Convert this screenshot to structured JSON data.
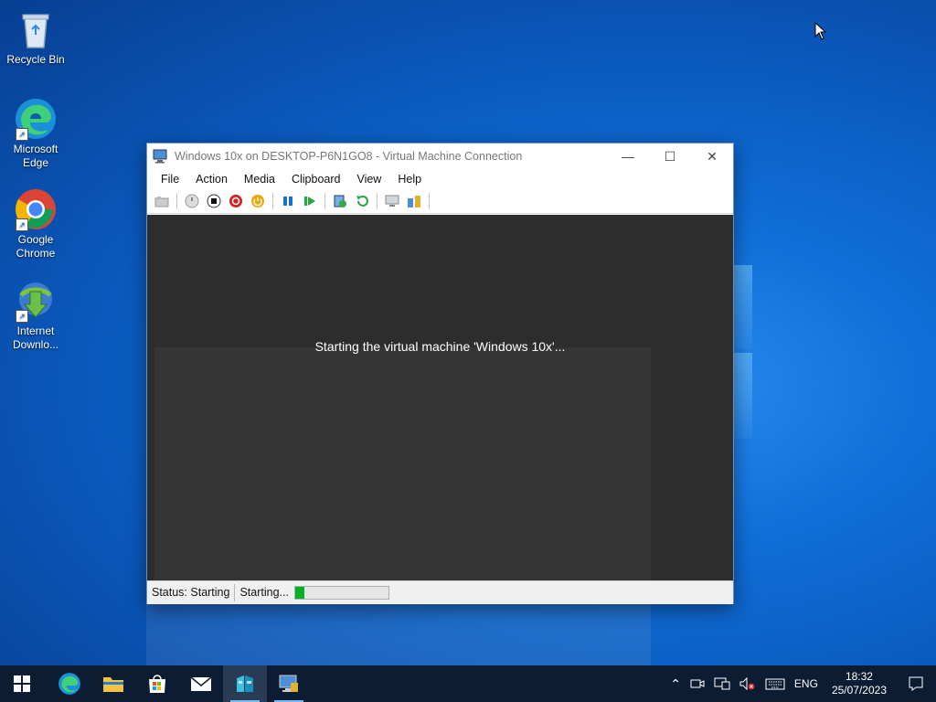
{
  "desktop": {
    "icons": [
      {
        "label": "Recycle Bin"
      },
      {
        "label": "Microsoft Edge"
      },
      {
        "label": "Google Chrome"
      },
      {
        "label": "Internet Downlo..."
      }
    ]
  },
  "vm_window": {
    "title": "Windows 10x on DESKTOP-P6N1GO8 - Virtual Machine Connection",
    "menu": [
      "File",
      "Action",
      "Media",
      "Clipboard",
      "View",
      "Help"
    ],
    "toolbar": [
      "ctrl-alt-del-icon",
      "start-icon",
      "turn-off-icon",
      "shut-down-icon",
      "save-state-icon",
      "pause-icon",
      "resume-icon",
      "checkpoint-icon",
      "revert-icon",
      "enhanced-session-icon",
      "share-icon"
    ],
    "screen_message": "Starting the virtual machine 'Windows 10x'...",
    "status_label": "Status: Starting",
    "progress_label": "Starting...",
    "progress_fraction": 0.1,
    "colors": {
      "progress": "#06b025",
      "screen": "#2d2d2d"
    }
  },
  "taskbar": {
    "apps": [
      "start-icon",
      "edge-icon",
      "file-explorer-icon",
      "store-icon",
      "mail-icon",
      "hyper-v-manager-icon",
      "vm-connection-icon"
    ],
    "tray": {
      "language": "ENG",
      "time": "18:32",
      "date": "25/07/2023"
    }
  }
}
